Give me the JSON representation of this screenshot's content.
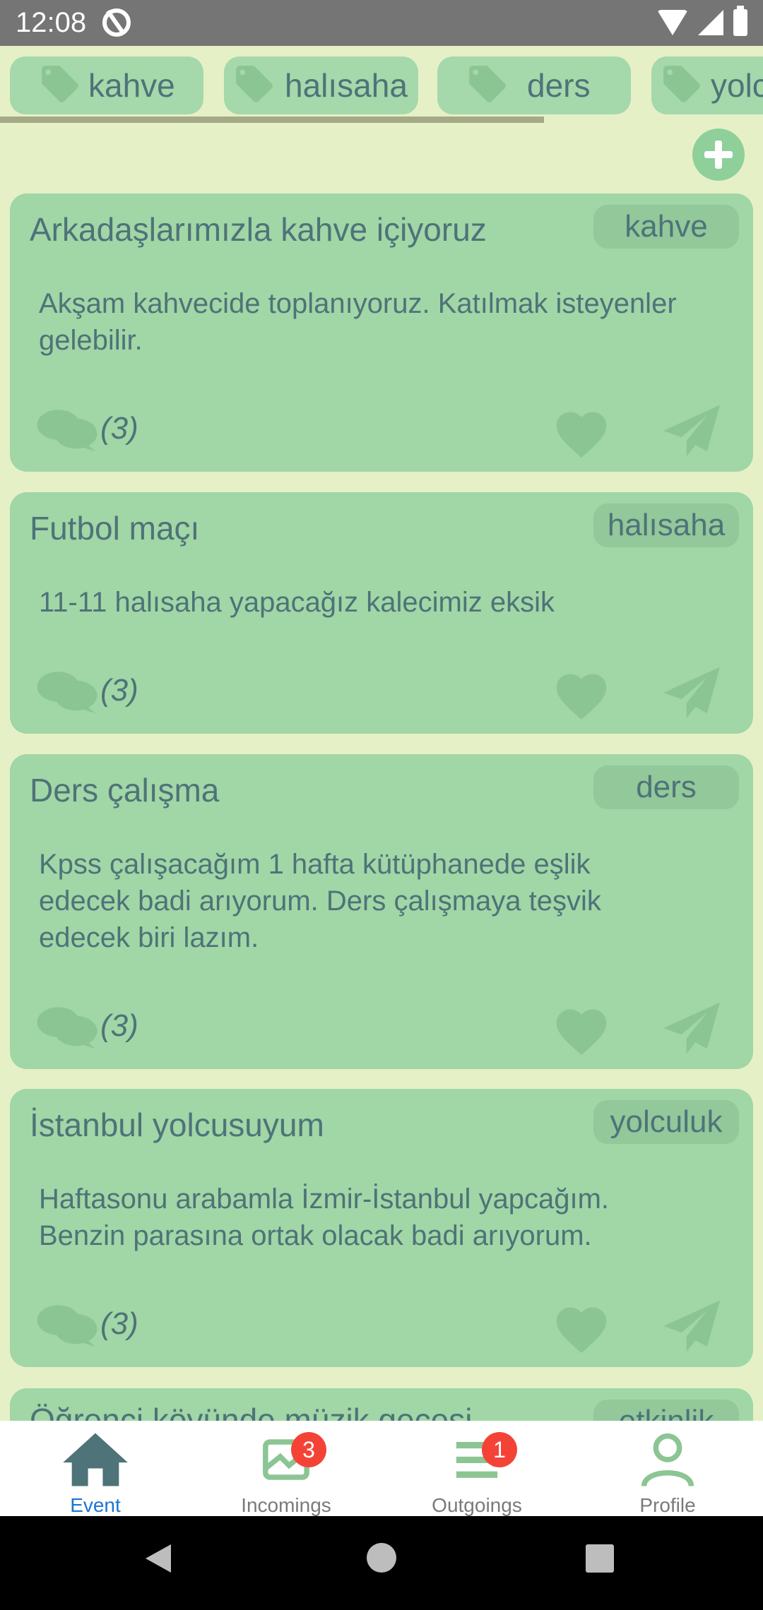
{
  "status_bar": {
    "time": "12:08"
  },
  "tags": [
    {
      "label": "kahve"
    },
    {
      "label": "halısaha"
    },
    {
      "label": "ders"
    },
    {
      "label": "yolc"
    }
  ],
  "add_button": {
    "icon": "plus-circle-icon"
  },
  "events": [
    {
      "title": "Arkadaşlarımızla kahve içiyoruz",
      "tag": "kahve",
      "description": "Akşam kahvecide toplanıyoruz. Katılmak isteyenler gelebilir.",
      "comments": "(3)"
    },
    {
      "title": "Futbol maçı",
      "tag": "halısaha",
      "description": "11-11 halısaha yapacağız kalecimiz eksik",
      "comments": "(3)"
    },
    {
      "title": "Ders çalışma",
      "tag": "ders",
      "description": "Kpss çalışacağım 1 hafta kütüphanede eşlik edecek badi arıyorum. Ders çalışmaya teşvik edecek biri lazım.",
      "comments": "(3)"
    },
    {
      "title": "İstanbul yolcusuyum",
      "tag": "yolculuk",
      "description": "Haftasonu arabamla İzmir-İstanbul yapcağım. Benzin parasına ortak olacak badi arıyorum.",
      "comments": "(3)"
    },
    {
      "title": "Öğrenci köyünde müzik gecesi",
      "tag": "etkinlik",
      "description": "",
      "comments": ""
    }
  ],
  "bottom_nav": {
    "event": {
      "label": "Event",
      "icon": "home-icon"
    },
    "incomings": {
      "label": "Incomings",
      "icon": "incoming-icon",
      "badge": "3"
    },
    "outgoings": {
      "label": "Outgoings",
      "icon": "list-icon",
      "badge": "1"
    },
    "profile": {
      "label": "Profile",
      "icon": "person-icon"
    }
  },
  "colors": {
    "background": "#e6f0c6",
    "card": "#a1d6a6",
    "text": "#4e7378",
    "active_nav": "#1976d2",
    "badge": "#f44336"
  }
}
